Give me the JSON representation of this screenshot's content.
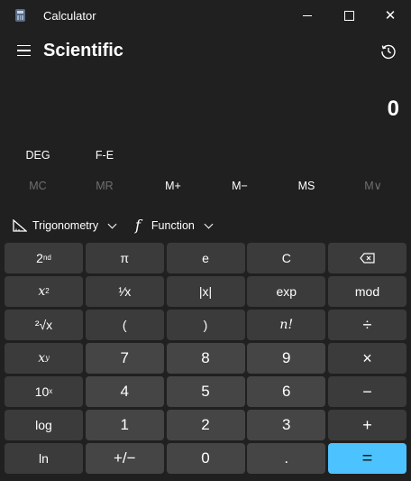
{
  "window": {
    "title": "Calculator",
    "minimize_icon": "minimize-icon",
    "maximize_icon": "maximize-icon",
    "close_icon": "close-icon",
    "close_glyph": "✕"
  },
  "header": {
    "mode": "Scientific",
    "menu_icon": "hamburger-icon",
    "history_icon": "history-icon"
  },
  "display": {
    "value": "0"
  },
  "angle_row": {
    "deg": "DEG",
    "fe": "F-E"
  },
  "memory": {
    "mc": "MC",
    "mr": "MR",
    "mplus": "M+",
    "mminus": "M−",
    "ms": "MS",
    "mlist": "M∨"
  },
  "functions": {
    "trig": "Trigonometry",
    "func": "Function",
    "func_symbol": "f"
  },
  "keys": {
    "second_base": "2",
    "second_sup": "nd",
    "pi": "π",
    "e": "e",
    "clear": "C",
    "x_base": "x",
    "x_sup": "2",
    "reciprocal": "¹⁄x",
    "abs": "|x|",
    "exp": "exp",
    "mod": "mod",
    "root": "²√x",
    "lparen": "(",
    "rparen": ")",
    "fact": "n!",
    "divide": "÷",
    "xy_base": "x",
    "xy_sup": "y",
    "seven": "7",
    "eight": "8",
    "nine": "9",
    "multiply": "×",
    "tenx_base": "10",
    "tenx_sup": "x",
    "four": "4",
    "five": "5",
    "six": "6",
    "minus": "−",
    "log": "log",
    "one": "1",
    "two": "2",
    "three": "3",
    "plus": "+",
    "ln": "ln",
    "negate": "+/−",
    "zero": "0",
    "decimal": ".",
    "equals": "="
  },
  "colors": {
    "accent": "#4cc2ff",
    "background": "#202020",
    "key": "#3b3b3b",
    "number_key": "#454545"
  }
}
